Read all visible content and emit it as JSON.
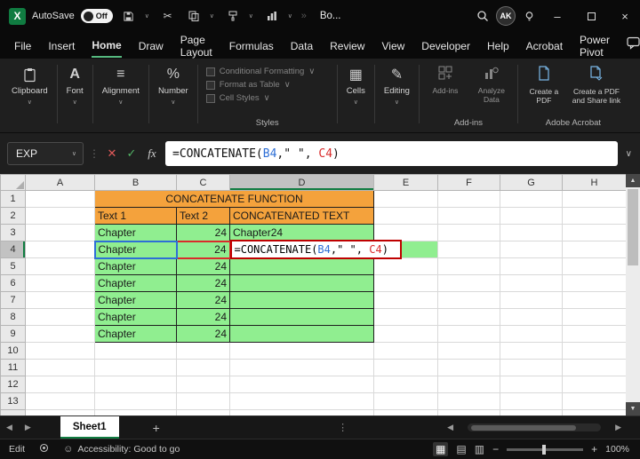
{
  "colors": {
    "accent_green": "#107C41",
    "header_orange": "#F4A23C",
    "title_red": "#E10000",
    "cell_green": "#90EE90",
    "ref_blue": "#2E6FD6",
    "ref_red": "#D92B2B"
  },
  "titlebar": {
    "autosave_label": "AutoSave",
    "autosave_state": "Off",
    "doc_title": "Bo...",
    "avatar_initials": "AK"
  },
  "menubar": {
    "items": [
      "File",
      "Insert",
      "Home",
      "Draw",
      "Page Layout",
      "Formulas",
      "Data",
      "Review",
      "View",
      "Developer",
      "Help",
      "Acrobat",
      "Power Pivot"
    ]
  },
  "ribbon": {
    "clipboard": "Clipboard",
    "font": "Font",
    "alignment": "Alignment",
    "number": "Number",
    "styles": {
      "label": "Styles",
      "items": [
        "Conditional Formatting",
        "Format as Table",
        "Cell Styles"
      ]
    },
    "cells": "Cells",
    "editing": "Editing",
    "addins": {
      "label": "Add-ins",
      "items": [
        "Add-ins",
        "Analyze Data"
      ]
    },
    "acrobat": {
      "label": "Adobe Acrobat",
      "items": [
        "Create a PDF",
        "Create a PDF and Share link"
      ]
    }
  },
  "formula_bar": {
    "name_box": "EXP",
    "fx": "fx",
    "formula": {
      "prefix": "=CONCATENATE(",
      "ref1": "B4",
      "mid": ",\" \", ",
      "ref2": "C4",
      "suffix": ")"
    }
  },
  "grid": {
    "columns": [
      "A",
      "B",
      "C",
      "D",
      "E",
      "F",
      "G",
      "H"
    ],
    "row_numbers": [
      "1",
      "2",
      "3",
      "4",
      "5",
      "6",
      "7",
      "8",
      "9",
      "10",
      "11",
      "12",
      "13"
    ],
    "title": "CONCATENATE FUNCTION",
    "headers": {
      "text1": "Text 1",
      "text2": "Text 2",
      "result": "CONCATENATED TEXT"
    },
    "data_rows": [
      {
        "text1": "Chapter",
        "text2": "24",
        "result": "Chapter24"
      },
      {
        "text1": "Chapter",
        "text2": "24",
        "result": ""
      },
      {
        "text1": "Chapter",
        "text2": "24",
        "result": ""
      },
      {
        "text1": "Chapter",
        "text2": "24",
        "result": ""
      },
      {
        "text1": "Chapter",
        "text2": "24",
        "result": ""
      },
      {
        "text1": "Chapter",
        "text2": "24",
        "result": ""
      },
      {
        "text1": "Chapter",
        "text2": "24",
        "result": ""
      }
    ]
  },
  "sheet_tabs": {
    "active": "Sheet1",
    "add": "+"
  },
  "status_bar": {
    "mode": "Edit",
    "accessibility": "Accessibility: Good to go",
    "zoom": "100%"
  }
}
